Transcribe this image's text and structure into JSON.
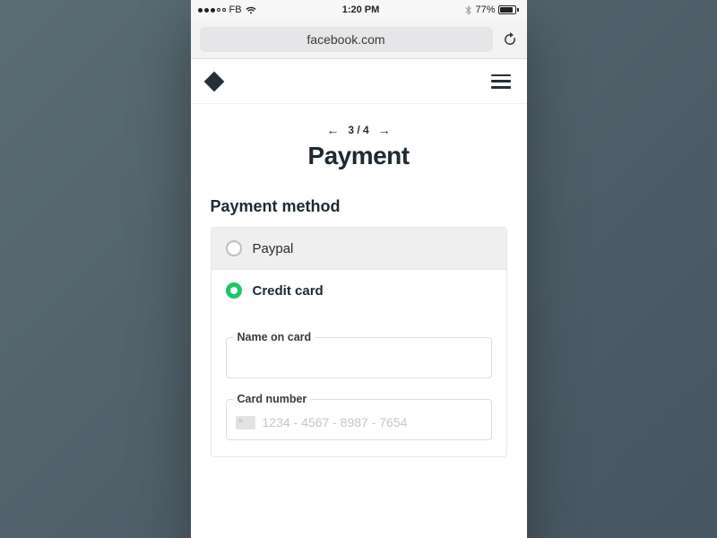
{
  "statusbar": {
    "carrier": "FB",
    "time": "1:20 PM",
    "battery_pct": "77%"
  },
  "browser": {
    "url": "facebook.com"
  },
  "stepper": {
    "position": "3 / 4"
  },
  "title": "Payment",
  "section": {
    "heading": "Payment method",
    "options": {
      "paypal": {
        "label": "Paypal"
      },
      "credit_card": {
        "label": "Credit card"
      }
    }
  },
  "card_form": {
    "name_label": "Name on card",
    "number_label": "Card number",
    "number_placeholder": "1234 - 4567 - 8987 - 7654"
  }
}
